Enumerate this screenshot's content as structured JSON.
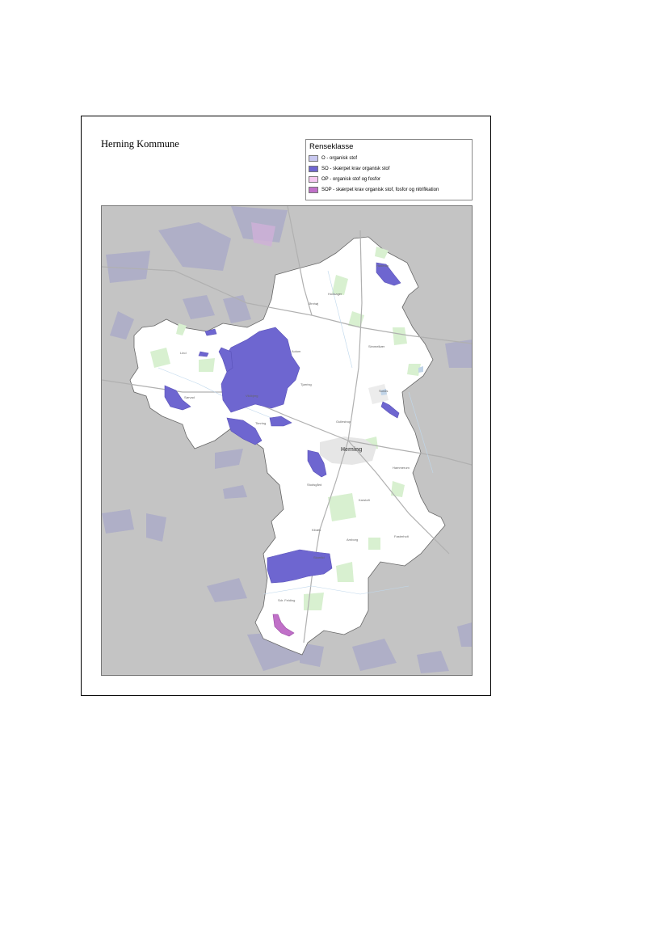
{
  "map": {
    "title": "Herning Kommune",
    "legend": {
      "title": "Renseklasse",
      "items": [
        {
          "label": "O - organisk stof",
          "color": "#c8c8f0"
        },
        {
          "label": "SO - skærpet krav organisk stof",
          "color": "#6e66d0"
        },
        {
          "label": "OP - organisk stof og fosfor",
          "color": "#f4c8f0"
        },
        {
          "label": "SOP - skærpet krav organisk stof, fosfor og nitrifikation",
          "color": "#c070c8"
        }
      ]
    },
    "places": {
      "main": "Herning",
      "p1": "Haderup",
      "p2": "Vildbjerg",
      "p3": "Gullestrup",
      "p4": "Sunds",
      "p5": "Kibæk",
      "p6": "Aulum",
      "p7": "Sørvad",
      "p8": "Timring",
      "p9": "Studsgård",
      "p10": "Arnborg",
      "p11": "Hodsager",
      "p12": "Ørnhøj",
      "p13": "Tjørring",
      "p14": "Sdr. Felding",
      "p15": "Hammerum",
      "p16": "Simmelkær",
      "p17": "Lind",
      "p18": "Karstoft",
      "p19": "Fasterholt",
      "p20": "Skarrild"
    },
    "colors": {
      "outside": "#c4c4c4",
      "municipality": "#ffffff",
      "forest": "#d8f0d0",
      "so": "#6e66d0",
      "sop": "#c070c8",
      "o_outside": "#a8a8c8"
    }
  }
}
